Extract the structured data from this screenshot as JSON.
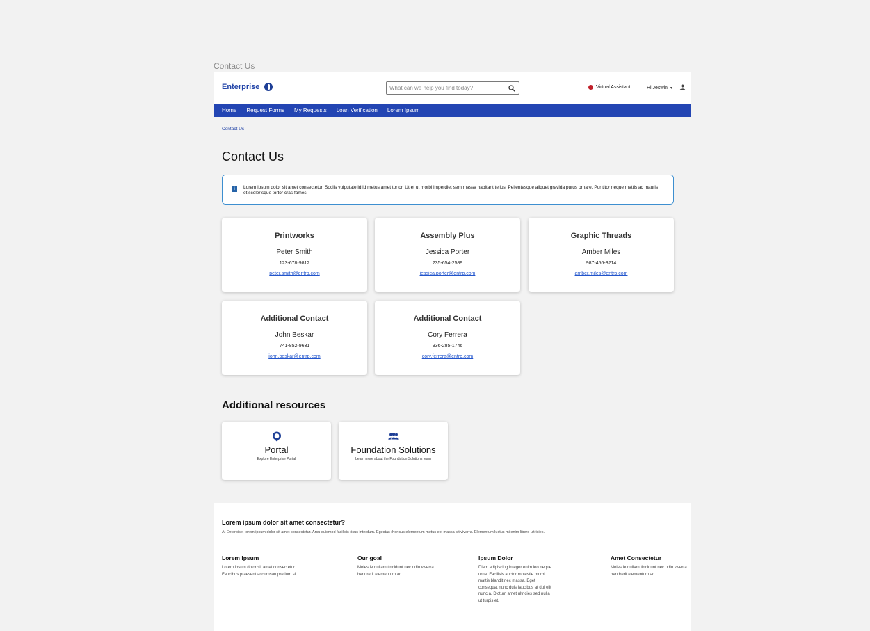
{
  "frame_label": "Contact Us",
  "header": {
    "brand": "Enterprise",
    "search_placeholder": "What can we help you find today?",
    "virtual_assistant": "Virtual Assistant",
    "greeting": "Hi Jeswin",
    "colors": {
      "brand": "#2345a8",
      "nav": "#2345b3",
      "assistant_dot": "#c0202a"
    }
  },
  "nav": {
    "items": [
      "Home",
      "Request Forms",
      "My Requests",
      "Loan Verification",
      "Lorem Ipsum"
    ]
  },
  "breadcrumb": "Contact Us",
  "page_title": "Contact Us",
  "alert": {
    "icon": "info-icon",
    "text": "Lorem ipsum dolor sit amet consectetur. Sociis vulputate id id metus amet tortor. Ut et ut morbi imperdiet sem massa habitant tellus. Pellentesque aliquet gravida purus ornare. Porttitor neque mattis ac mauris et scelerisque tortor cras fames."
  },
  "contacts": [
    {
      "title": "Printworks",
      "name": "Peter Smith",
      "phone": "123-678-9812",
      "email": "peter.smith@entrp.com"
    },
    {
      "title": "Assembly Plus",
      "name": "Jessica Porter",
      "phone": "235-654-2589",
      "email": "jessica.porter@entrp.com"
    },
    {
      "title": "Graphic Threads",
      "name": "Amber Miles",
      "phone": "987-456-3214",
      "email": "amber.miles@entrp.com"
    },
    {
      "title": "Additional Contact",
      "name": "John Beskar",
      "phone": "741-852-9631",
      "email": "john.beskar@entrp.com"
    },
    {
      "title": "Additional Contact",
      "name": "Cory Ferrera",
      "phone": "936-285-1746",
      "email": "cory.ferrera@entrp.com"
    }
  ],
  "resources": {
    "title": "Additional resources",
    "items": [
      {
        "icon": "portal-icon",
        "title": "Portal",
        "description": "Explore Enterprise Portal"
      },
      {
        "icon": "team-icon",
        "title": "Foundation Solutions",
        "description": "Learn more about the Foundation Solutions team"
      }
    ]
  },
  "footer": {
    "heading": "Lorem ipsum dolor sit amet consectetur?",
    "subheading": "At Enterpise, lorem ipsum dolor sit amet consectetur. Arcu euismod facilisis risus interdum. Egestas rhoncus elementum metus est massa sit viverra. Elementum luctus mi enim libero ultricies.",
    "columns": [
      {
        "title": "Lorem Ipsum",
        "text": "Lorem ipsum dolor sit amet consectetur. Faucibus praesent accumsan pretium sit."
      },
      {
        "title": "Our goal",
        "text": "Molestie nullam tincidunt nec odio viverra hendrerit elementum ac."
      },
      {
        "title": "Ipsum Dolor",
        "text": "Diam adipiscing integer enim leo neque urna. Facilisis auctor molestie morbi mattis blandit nec massa. Eget consequat nunc duis faucibus at dui elit nunc a. Dictum amet ultricies sed nulla ut turpis et."
      },
      {
        "title": "Amet Consectetur",
        "text": "Molestie nullam tincidunt nec odio viverra hendrerit elementum ac."
      }
    ]
  }
}
